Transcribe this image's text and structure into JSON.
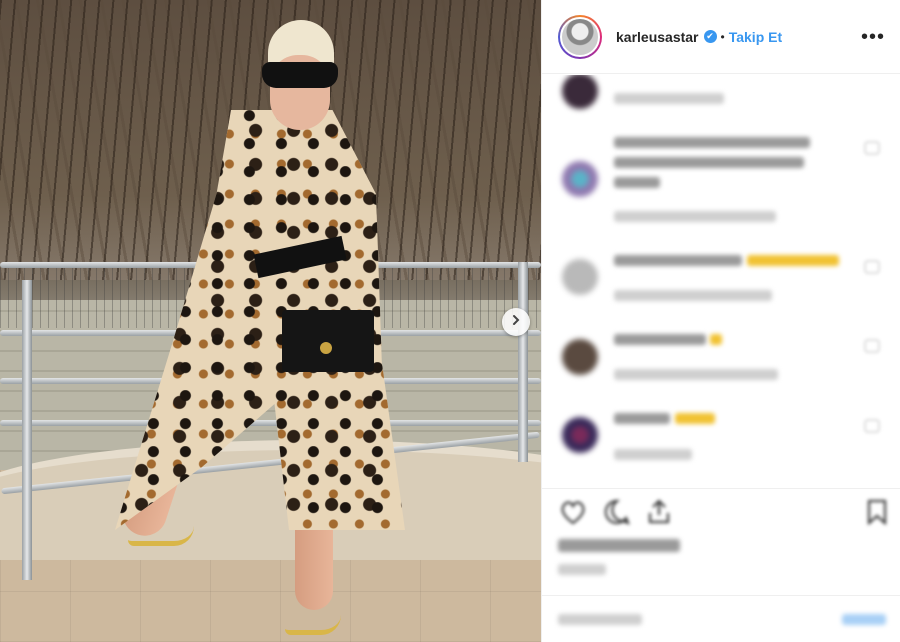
{
  "post": {
    "username": "karleusastar",
    "verified_glyph": "✔",
    "separator": "•",
    "follow_label": "Takip Et",
    "more_label": "•••"
  },
  "icons": {
    "verified": "verified-badge-icon",
    "next": "chevron-right-icon",
    "options": "more-options-icon",
    "like": "heart-icon",
    "comment": "comment-bubble-icon",
    "share": "share-icon",
    "save": "bookmark-icon"
  },
  "colors": {
    "accent": "#3897f0",
    "text": "#262626",
    "divider": "#efefef",
    "story_ring": [
      "#f58529",
      "#dd2a7b",
      "#8134af",
      "#515bd4"
    ]
  },
  "comments_visible": 5,
  "blurred": "comment text, like count, date and comment box are blurred/obscured in the screenshot"
}
